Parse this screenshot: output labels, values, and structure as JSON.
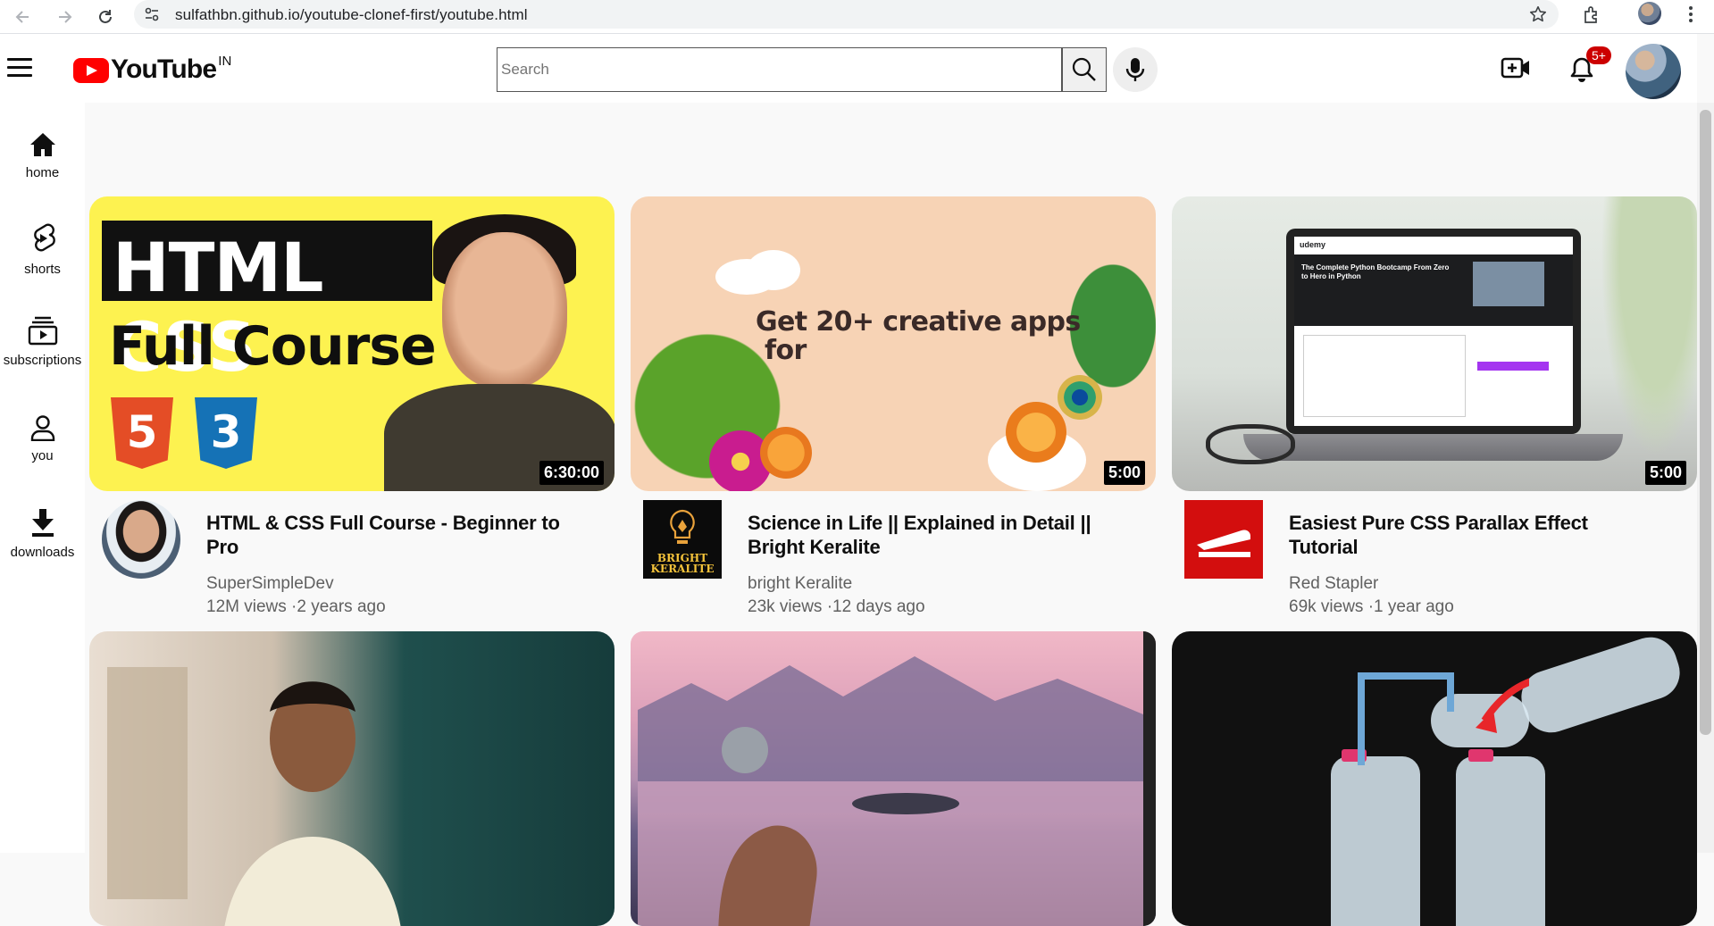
{
  "browser": {
    "url": "sulfathbn.github.io/youtube-clonef-first/youtube.html"
  },
  "header": {
    "logo_text": "YouTube",
    "country": "IN",
    "search_placeholder": "Search",
    "notification_badge": "5+"
  },
  "sidebar": {
    "items": [
      {
        "label": "home",
        "icon": "home-icon"
      },
      {
        "label": "shorts",
        "icon": "shorts-icon"
      },
      {
        "label": "subscriptions",
        "icon": "subscriptions-icon"
      },
      {
        "label": "you",
        "icon": "user-icon"
      },
      {
        "label": "downloads",
        "icon": "download-icon"
      }
    ]
  },
  "videos": [
    {
      "title": "HTML & CSS Full Course - Beginner to Pro",
      "channel": "SuperSimpleDev",
      "stats": "12M views ·2 years ago",
      "duration": "6:30:00",
      "thumb_title_1": "HTML CSS",
      "thumb_title_2": "Full Course"
    },
    {
      "title": "Science in Life || Explained in Detail || Bright Keralite",
      "channel": "bright Keralite",
      "stats": "23k views ·12 days ago",
      "duration": "5:00",
      "thumb_text_1": "Get 20+ creative apps",
      "thumb_text_2": "for",
      "channel_logo_text_1": "BRIGHT",
      "channel_logo_text_2": "KERALITE"
    },
    {
      "title": "Easiest Pure CSS Parallax Effect Tutorial",
      "channel": "Red Stapler",
      "stats": "69k views ·1 year ago",
      "duration": "5:00",
      "screen_brand": "udemy",
      "screen_heading": "The Complete Python Bootcamp From Zero to Hero in Python"
    }
  ],
  "colors": {
    "youtube_red": "#ff0000",
    "badge_red": "#cc0000",
    "secondary_text": "#606060"
  }
}
